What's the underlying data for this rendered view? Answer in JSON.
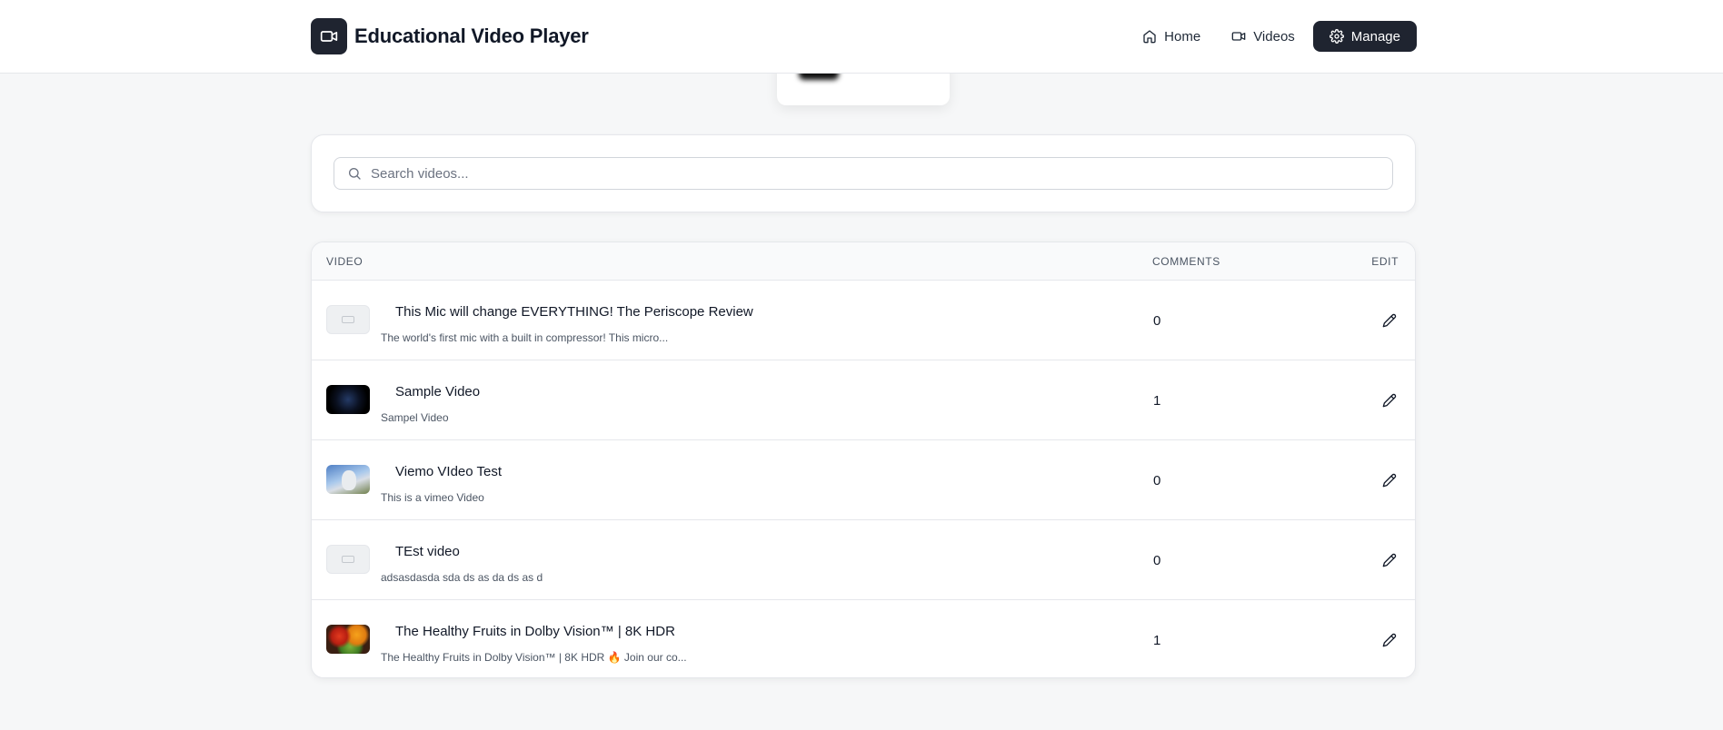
{
  "app": {
    "title": "Educational Video Player"
  },
  "nav": [
    {
      "label": "Home",
      "icon": "home-icon",
      "active": false
    },
    {
      "label": "Videos",
      "icon": "video-icon",
      "active": false
    },
    {
      "label": "Manage",
      "icon": "gear-icon",
      "active": true
    }
  ],
  "search": {
    "placeholder": "Search videos...",
    "value": ""
  },
  "table": {
    "headers": {
      "video": "VIDEO",
      "comments": "COMMENTS",
      "edit": "EDIT"
    },
    "rows": [
      {
        "title": "This Mic will change EVERYTHING! The Periscope Review",
        "description": "The world's first mic with a built in compressor! This micro...",
        "comments": "0",
        "thumbnail": "placeholder"
      },
      {
        "title": "Sample Video",
        "description": "Sampel Video",
        "comments": "1",
        "thumbnail": "dark-planet"
      },
      {
        "title": "Viemo VIdeo Test",
        "description": "This is a vimeo Video",
        "comments": "0",
        "thumbnail": "rabbit-sky"
      },
      {
        "title": "TEst video",
        "description": "adsasdasda sda ds as da ds as d",
        "comments": "0",
        "thumbnail": "placeholder"
      },
      {
        "title": "The Healthy Fruits in Dolby Vision™ | 8K HDR",
        "description": "The Healthy Fruits in Dolby Vision™ | 8K HDR 🔥 Join our co...",
        "comments": "1",
        "thumbnail": "fruits"
      }
    ]
  },
  "colors": {
    "primary": "#1f2430",
    "background": "#f6f7f8",
    "border": "#e5e7eb",
    "muted_text": "#4b5563"
  }
}
